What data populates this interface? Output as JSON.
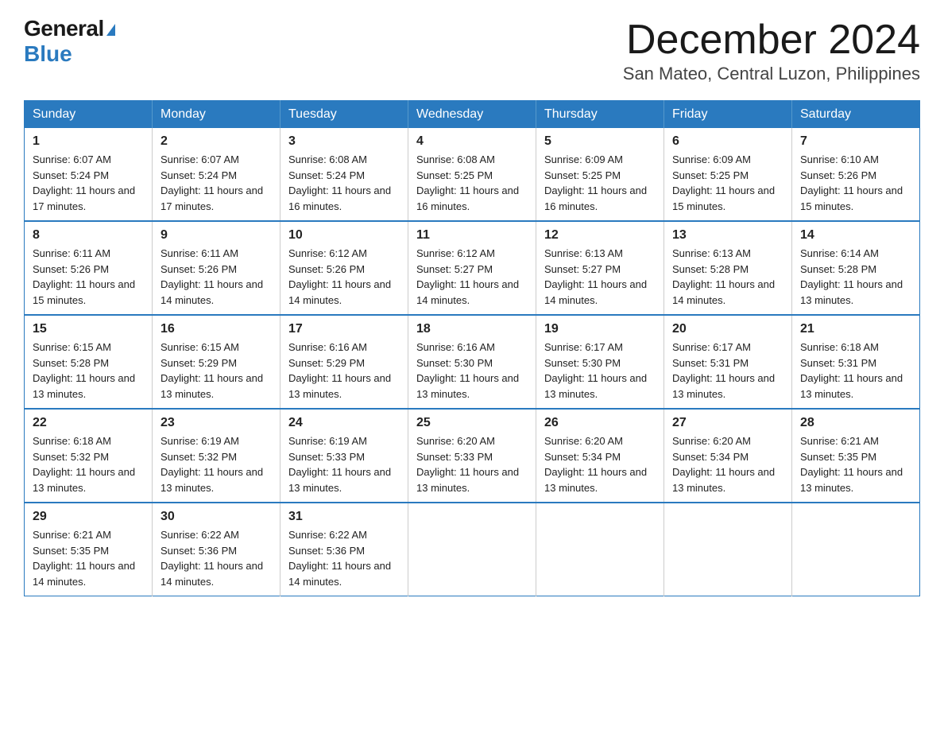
{
  "logo": {
    "general": "General",
    "blue": "Blue",
    "triangle": "▲"
  },
  "title": "December 2024",
  "subtitle": "San Mateo, Central Luzon, Philippines",
  "days_of_week": [
    "Sunday",
    "Monday",
    "Tuesday",
    "Wednesday",
    "Thursday",
    "Friday",
    "Saturday"
  ],
  "weeks": [
    [
      {
        "day": "1",
        "sunrise": "6:07 AM",
        "sunset": "5:24 PM",
        "daylight": "11 hours and 17 minutes."
      },
      {
        "day": "2",
        "sunrise": "6:07 AM",
        "sunset": "5:24 PM",
        "daylight": "11 hours and 17 minutes."
      },
      {
        "day": "3",
        "sunrise": "6:08 AM",
        "sunset": "5:24 PM",
        "daylight": "11 hours and 16 minutes."
      },
      {
        "day": "4",
        "sunrise": "6:08 AM",
        "sunset": "5:25 PM",
        "daylight": "11 hours and 16 minutes."
      },
      {
        "day": "5",
        "sunrise": "6:09 AM",
        "sunset": "5:25 PM",
        "daylight": "11 hours and 16 minutes."
      },
      {
        "day": "6",
        "sunrise": "6:09 AM",
        "sunset": "5:25 PM",
        "daylight": "11 hours and 15 minutes."
      },
      {
        "day": "7",
        "sunrise": "6:10 AM",
        "sunset": "5:26 PM",
        "daylight": "11 hours and 15 minutes."
      }
    ],
    [
      {
        "day": "8",
        "sunrise": "6:11 AM",
        "sunset": "5:26 PM",
        "daylight": "11 hours and 15 minutes."
      },
      {
        "day": "9",
        "sunrise": "6:11 AM",
        "sunset": "5:26 PM",
        "daylight": "11 hours and 14 minutes."
      },
      {
        "day": "10",
        "sunrise": "6:12 AM",
        "sunset": "5:26 PM",
        "daylight": "11 hours and 14 minutes."
      },
      {
        "day": "11",
        "sunrise": "6:12 AM",
        "sunset": "5:27 PM",
        "daylight": "11 hours and 14 minutes."
      },
      {
        "day": "12",
        "sunrise": "6:13 AM",
        "sunset": "5:27 PM",
        "daylight": "11 hours and 14 minutes."
      },
      {
        "day": "13",
        "sunrise": "6:13 AM",
        "sunset": "5:28 PM",
        "daylight": "11 hours and 14 minutes."
      },
      {
        "day": "14",
        "sunrise": "6:14 AM",
        "sunset": "5:28 PM",
        "daylight": "11 hours and 13 minutes."
      }
    ],
    [
      {
        "day": "15",
        "sunrise": "6:15 AM",
        "sunset": "5:28 PM",
        "daylight": "11 hours and 13 minutes."
      },
      {
        "day": "16",
        "sunrise": "6:15 AM",
        "sunset": "5:29 PM",
        "daylight": "11 hours and 13 minutes."
      },
      {
        "day": "17",
        "sunrise": "6:16 AM",
        "sunset": "5:29 PM",
        "daylight": "11 hours and 13 minutes."
      },
      {
        "day": "18",
        "sunrise": "6:16 AM",
        "sunset": "5:30 PM",
        "daylight": "11 hours and 13 minutes."
      },
      {
        "day": "19",
        "sunrise": "6:17 AM",
        "sunset": "5:30 PM",
        "daylight": "11 hours and 13 minutes."
      },
      {
        "day": "20",
        "sunrise": "6:17 AM",
        "sunset": "5:31 PM",
        "daylight": "11 hours and 13 minutes."
      },
      {
        "day": "21",
        "sunrise": "6:18 AM",
        "sunset": "5:31 PM",
        "daylight": "11 hours and 13 minutes."
      }
    ],
    [
      {
        "day": "22",
        "sunrise": "6:18 AM",
        "sunset": "5:32 PM",
        "daylight": "11 hours and 13 minutes."
      },
      {
        "day": "23",
        "sunrise": "6:19 AM",
        "sunset": "5:32 PM",
        "daylight": "11 hours and 13 minutes."
      },
      {
        "day": "24",
        "sunrise": "6:19 AM",
        "sunset": "5:33 PM",
        "daylight": "11 hours and 13 minutes."
      },
      {
        "day": "25",
        "sunrise": "6:20 AM",
        "sunset": "5:33 PM",
        "daylight": "11 hours and 13 minutes."
      },
      {
        "day": "26",
        "sunrise": "6:20 AM",
        "sunset": "5:34 PM",
        "daylight": "11 hours and 13 minutes."
      },
      {
        "day": "27",
        "sunrise": "6:20 AM",
        "sunset": "5:34 PM",
        "daylight": "11 hours and 13 minutes."
      },
      {
        "day": "28",
        "sunrise": "6:21 AM",
        "sunset": "5:35 PM",
        "daylight": "11 hours and 13 minutes."
      }
    ],
    [
      {
        "day": "29",
        "sunrise": "6:21 AM",
        "sunset": "5:35 PM",
        "daylight": "11 hours and 14 minutes."
      },
      {
        "day": "30",
        "sunrise": "6:22 AM",
        "sunset": "5:36 PM",
        "daylight": "11 hours and 14 minutes."
      },
      {
        "day": "31",
        "sunrise": "6:22 AM",
        "sunset": "5:36 PM",
        "daylight": "11 hours and 14 minutes."
      },
      null,
      null,
      null,
      null
    ]
  ]
}
